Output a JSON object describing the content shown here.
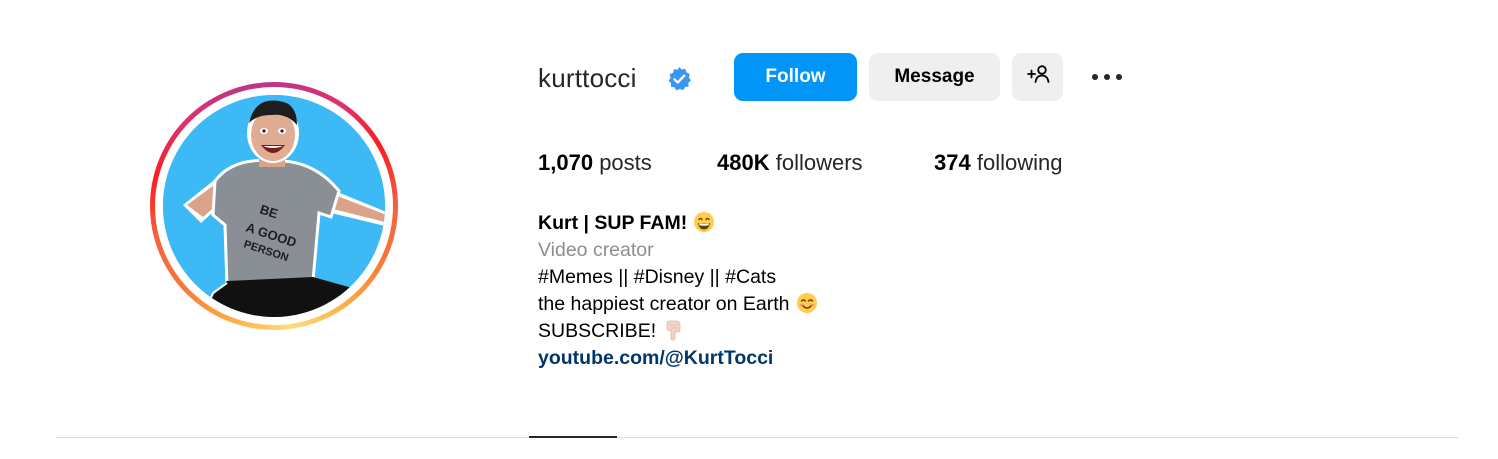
{
  "profile": {
    "username": "kurttocci",
    "verified": true,
    "avatar_alt": "kurttocci's profile picture",
    "story_ring": true
  },
  "actions": {
    "follow_label": "Follow",
    "message_label": "Message",
    "add_user_icon": "person-add-icon",
    "more_icon": "more-options-icon"
  },
  "stats": {
    "posts_count": "1,070",
    "posts_label": "posts",
    "followers_count": "480K",
    "followers_label": "followers",
    "following_count": "374",
    "following_label": "following"
  },
  "bio": {
    "name": "Kurt | SUP FAM!",
    "category": "Video creator",
    "line1": "#Memes || #Disney || #Cats",
    "line2": "the happiest creator on Earth",
    "line3": "SUBSCRIBE!",
    "link": "youtube.com/@KurtTocci"
  },
  "colors": {
    "follow_bg": "#0095f6",
    "secondary_btn_bg": "#efefef",
    "verified_badge": "#3897f0",
    "link": "#00376b",
    "category_text": "#8e8e8e",
    "avatar_bg": "#3db9f6"
  }
}
